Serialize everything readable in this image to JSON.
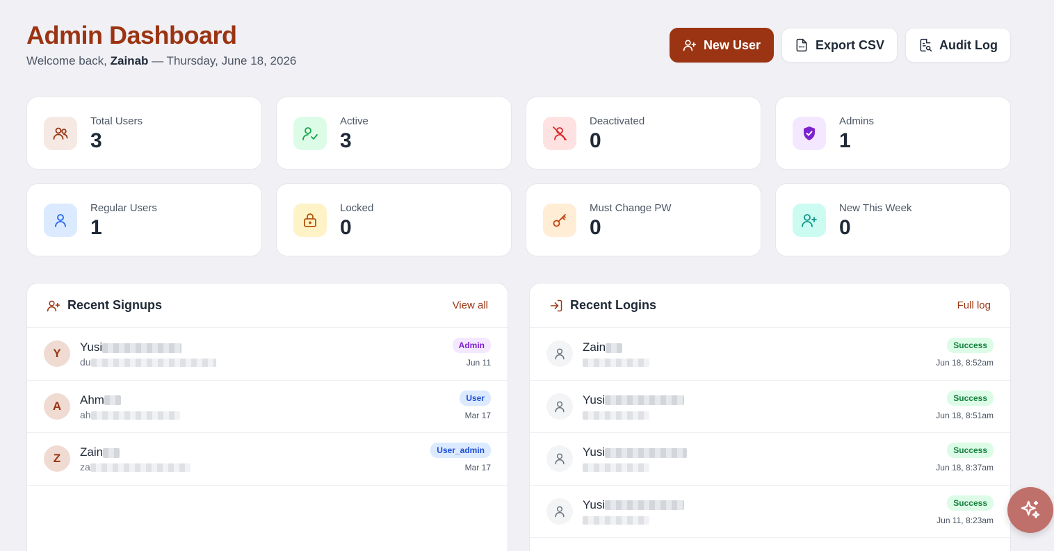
{
  "header": {
    "title": "Admin Dashboard",
    "welcome_prefix": "Welcome back, ",
    "user_name": "Zainab",
    "date_suffix": " — Thursday, June 18, 2026"
  },
  "actions": {
    "new_user": "New User",
    "export_csv": "Export CSV",
    "audit_log": "Audit Log"
  },
  "stats": [
    {
      "label": "Total Users",
      "value": "3",
      "icon": "users-icon",
      "color": "#9a3412",
      "bg": "#f6e9e3"
    },
    {
      "label": "Active",
      "value": "3",
      "icon": "user-check-icon",
      "color": "#16a34a",
      "bg": "#dcfce7"
    },
    {
      "label": "Deactivated",
      "value": "0",
      "icon": "user-x-icon",
      "color": "#dc2626",
      "bg": "#fee2e2"
    },
    {
      "label": "Admins",
      "value": "1",
      "icon": "shield-check-icon",
      "color": "#7e22ce",
      "bg": "#f3e8ff"
    },
    {
      "label": "Regular Users",
      "value": "1",
      "icon": "user-icon",
      "color": "#2563eb",
      "bg": "#dbeafe"
    },
    {
      "label": "Locked",
      "value": "0",
      "icon": "lock-icon",
      "color": "#b45309",
      "bg": "#fef3c7"
    },
    {
      "label": "Must Change PW",
      "value": "0",
      "icon": "key-icon",
      "color": "#c2410c",
      "bg": "#ffedd5"
    },
    {
      "label": "New This Week",
      "value": "0",
      "icon": "user-plus-icon",
      "color": "#0d9488",
      "bg": "#ccfbf1"
    }
  ],
  "signups": {
    "title": "Recent Signups",
    "link": "View all",
    "rows": [
      {
        "initial": "Y",
        "name": "Yusi",
        "email": "du",
        "role": "Admin",
        "role_class": "admin",
        "date": "Jun 11"
      },
      {
        "initial": "A",
        "name": "Ahm",
        "email": "ah",
        "role": "User",
        "role_class": "user",
        "date": "Mar 17"
      },
      {
        "initial": "Z",
        "name": "Zain",
        "email": "za",
        "role": "User_admin",
        "role_class": "user",
        "date": "Mar 17"
      }
    ]
  },
  "logins": {
    "title": "Recent Logins",
    "link": "Full log",
    "rows": [
      {
        "name": "Zain",
        "status": "Success",
        "date": "Jun 18, 8:52am"
      },
      {
        "name": "Yusi",
        "status": "Success",
        "date": "Jun 18, 8:51am"
      },
      {
        "name": "Yusi",
        "status": "Success",
        "date": "Jun 18, 8:37am"
      },
      {
        "name": "Yusi",
        "status": "Success",
        "date": "Jun 11, 8:23am"
      }
    ]
  },
  "colors": {
    "accent": "#9a3412",
    "background": "#f1f0f5"
  }
}
